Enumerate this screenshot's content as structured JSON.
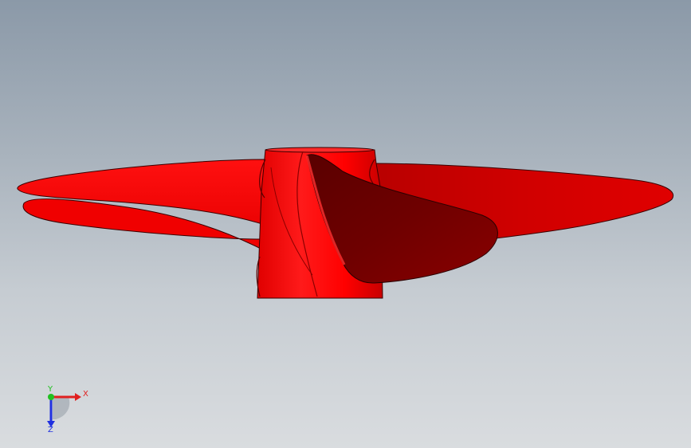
{
  "viewport": {
    "background_top": "#8b99a8",
    "background_bottom": "#d9dcdf"
  },
  "model": {
    "part": "propeller",
    "color": "#ff0000",
    "shadow_color": "#7a0000"
  },
  "triad": {
    "x_label": "X",
    "y_label": "Y",
    "z_label": "Z",
    "x_color": "#e02020",
    "y_color": "#20c020",
    "z_color": "#2030e0"
  }
}
